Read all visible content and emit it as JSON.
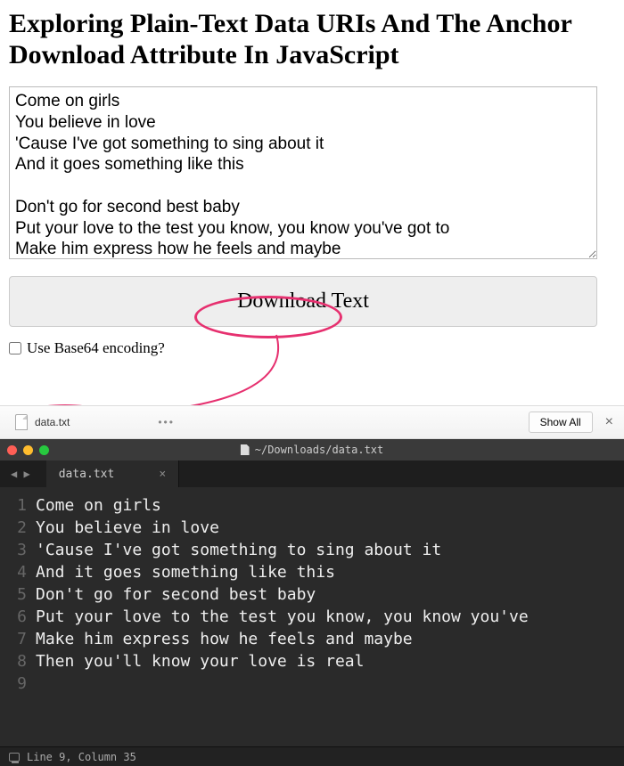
{
  "header": {
    "title": "Exploring Plain-Text Data URIs And The Anchor Download Attribute In JavaScript"
  },
  "textarea": {
    "value": "Come on girls\nYou believe in love\n'Cause I've got something to sing about it\nAnd it goes something like this\n\nDon't go for second best baby\nPut your love to the test you know, you know you've got to\nMake him express how he feels and maybe\nThen you'll know your love is real"
  },
  "button": {
    "download_label": "Download Text"
  },
  "checkbox": {
    "label": "Use Base64 encoding?"
  },
  "download_bar": {
    "filename": "data.txt",
    "show_all": "Show All"
  },
  "editor": {
    "titlebar_path": "~/Downloads/data.txt",
    "tab_name": "data.txt",
    "lines": [
      "Come on girls",
      "You believe in love",
      "'Cause I've got something to sing about it",
      "And it goes something like this",
      "",
      "Don't go for second best baby",
      "Put your love to the test you know, you know you've",
      "Make him express how he feels and maybe",
      "Then you'll know your love is real"
    ],
    "status": "Line 9, Column 35"
  }
}
